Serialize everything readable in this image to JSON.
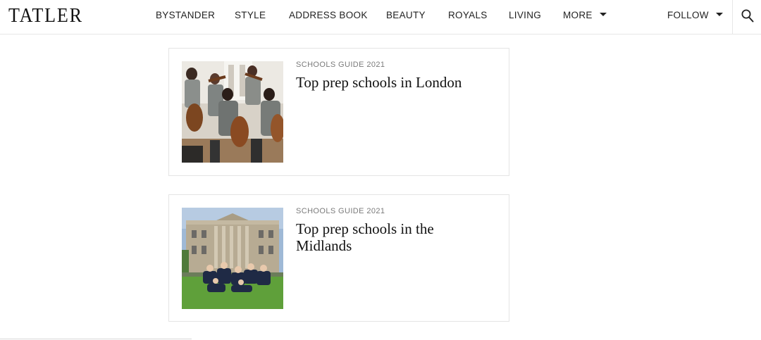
{
  "brand": {
    "logo": "TATLER"
  },
  "nav": {
    "items": [
      "BYSTANDER",
      "STYLE",
      "ADDRESS BOOK",
      "BEAUTY",
      "ROYALS",
      "LIVING"
    ],
    "more": "MORE",
    "follow": "FOLLOW"
  },
  "articles": [
    {
      "kicker": "SCHOOLS GUIDE 2021",
      "title": "Top prep schools in London",
      "image": "orchestra-students-photo"
    },
    {
      "kicker": "SCHOOLS GUIDE 2021",
      "title": "Top prep schools in the Midlands",
      "image": "school-building-pupils-photo"
    }
  ]
}
